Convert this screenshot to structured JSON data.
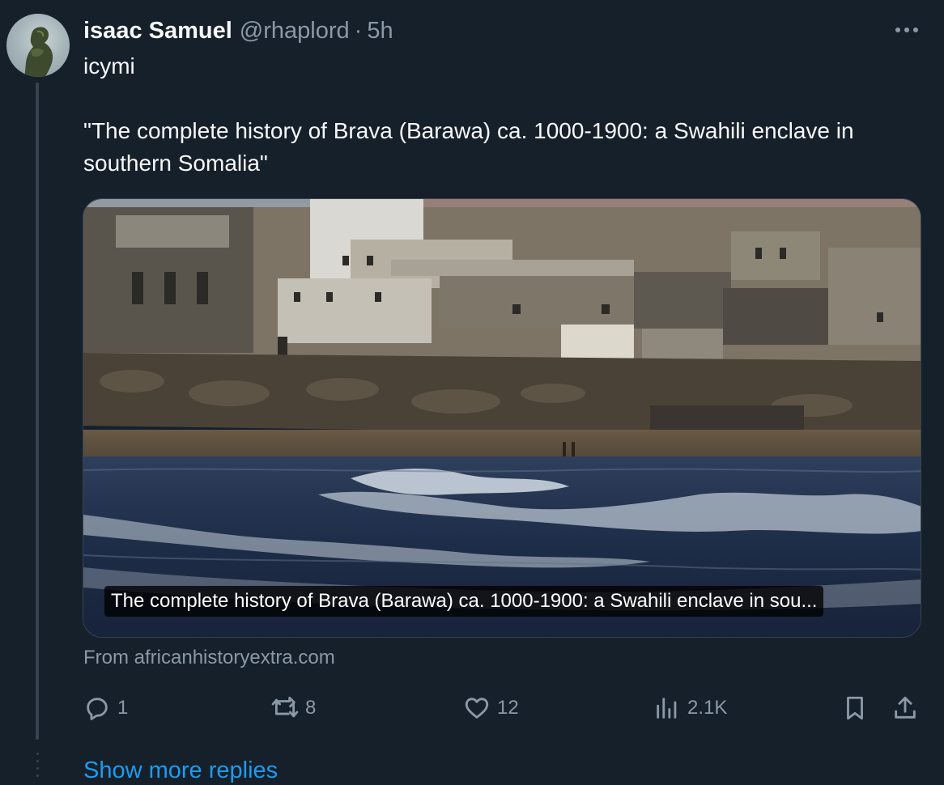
{
  "author": {
    "display_name": "isaac Samuel",
    "handle": "@rhaplord",
    "separator": "·",
    "time": "5h"
  },
  "tweet": {
    "line1": "icymi",
    "line2": "\"The complete history of Brava (Barawa) ca. 1000-1900: a Swahili enclave in southern Somalia\""
  },
  "card": {
    "title": "The complete history of Brava (Barawa) ca. 1000-1900: a Swahili enclave in sou...",
    "source": "From africanhistoryextra.com"
  },
  "actions": {
    "replies": "1",
    "reposts": "8",
    "likes": "12",
    "views": "2.1K"
  },
  "show_more": "Show more replies",
  "icons": {
    "more": "more-horizontal-icon",
    "reply": "reply-icon",
    "repost": "repost-icon",
    "like": "heart-icon",
    "views": "analytics-icon",
    "bookmark": "bookmark-icon",
    "share": "share-icon"
  },
  "colors": {
    "background": "#15202b",
    "text_primary": "#f7f9f9",
    "text_secondary": "#8b98a5",
    "link": "#1d9bf0",
    "border": "#38444d"
  }
}
